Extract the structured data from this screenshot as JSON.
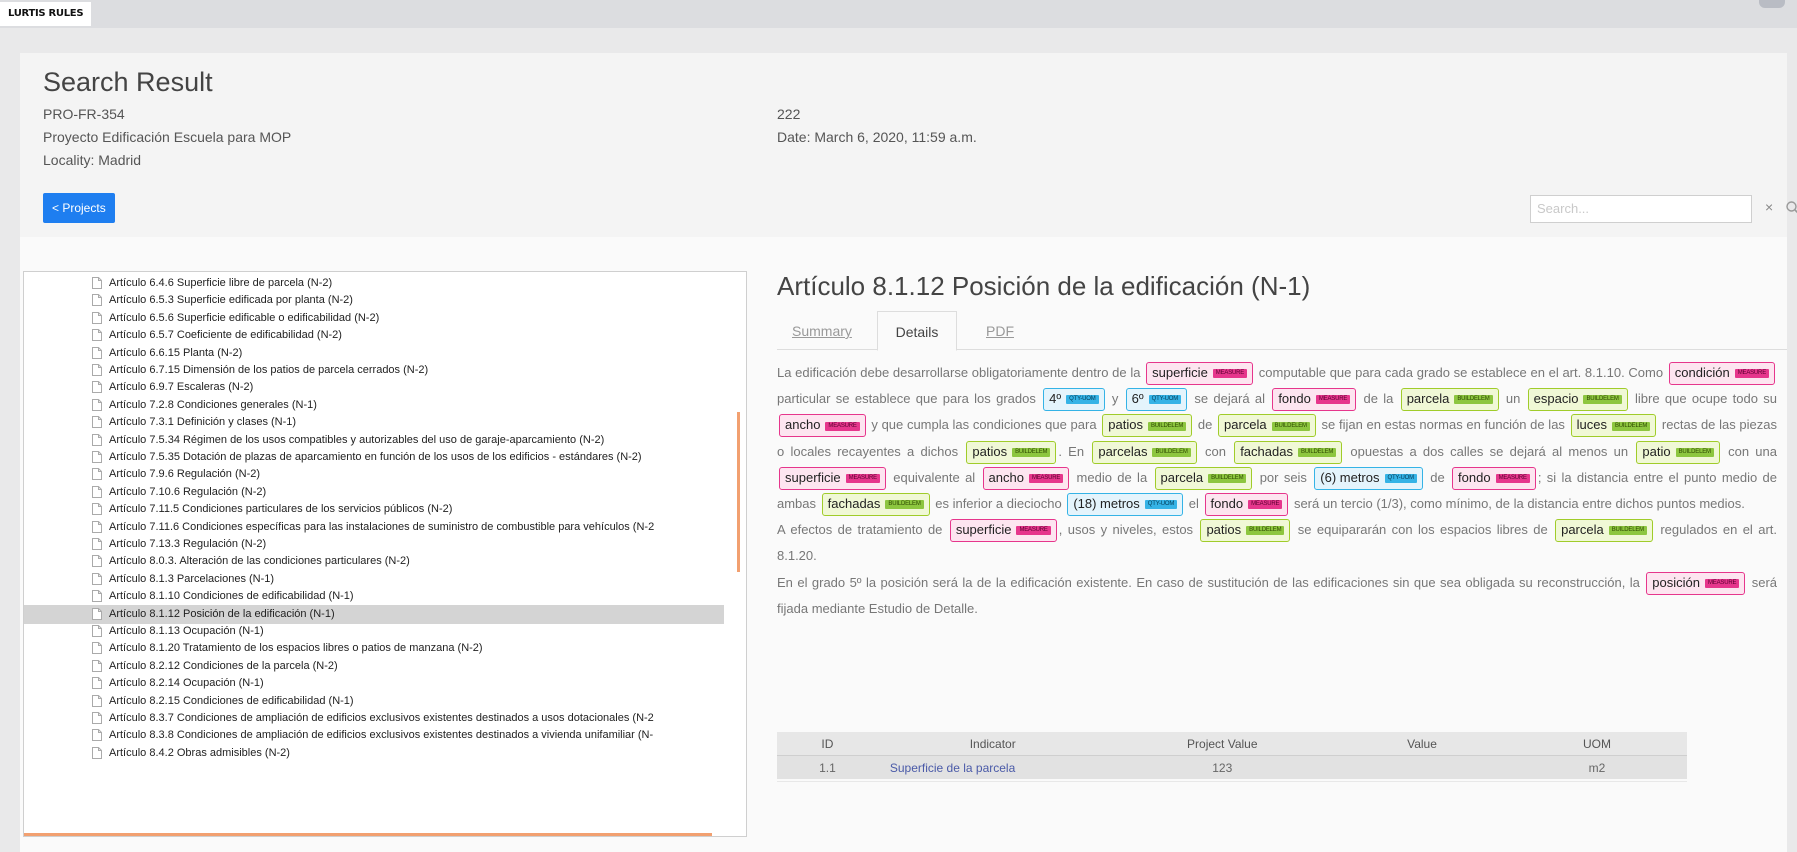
{
  "app": {
    "title": "LURTIS RULES"
  },
  "header": {
    "title": "Search Result",
    "project_code": "PRO-FR-354",
    "project_name": "Proyecto Edificación Escuela para MOP",
    "locality": "Locality: Madrid",
    "number": "222",
    "date": "Date: March 6, 2020, 11:59 a.m.",
    "back_button": "< Projects"
  },
  "search": {
    "placeholder": "Search...",
    "clear_symbol": "×",
    "icon": "search-icon"
  },
  "tree": {
    "items": [
      "Artículo 6.4.6 Superficie libre de parcela (N-2)",
      "Artículo 6.5.3 Superficie edificada por planta (N-2)",
      "Artículo 6.5.6 Superficie edificable o edificabilidad (N-2)",
      "Artículo 6.5.7 Coeficiente de edificabilidad (N-2)",
      "Artículo 6.6.15 Planta (N-2)",
      "Artículo 6.7.15 Dimensión de los patios de parcela cerrados (N-2)",
      "Artículo 6.9.7 Escaleras (N-2)",
      "Artículo 7.2.8 Condiciones generales (N-1)",
      "Artículo 7.3.1 Definición y clases (N-1)",
      "Artículo 7.5.34 Régimen de los usos compatibles y autorizables del uso de garaje-aparcamiento (N-2)",
      "Artículo 7.5.35 Dotación de plazas de aparcamiento en función de los usos de los edificios - estándares (N-2)",
      "Artículo 7.9.6 Regulación (N-2)",
      "Artículo 7.10.6 Regulación (N-2)",
      "Artículo 7.11.5 Condiciones particulares de los servicios públicos (N-2)",
      "Artículo 7.11.6 Condiciones específicas para las instalaciones de suministro de combustible para vehículos (N-2",
      "Artículo 7.13.3 Regulación (N-2)",
      "Artículo 8.0.3. Alteración de las condiciones particulares (N-2)",
      "Artículo 8.1.3 Parcelaciones (N-1)",
      "Artículo 8.1.10 Condiciones de edificabilidad (N-1)",
      "Artículo 8.1.12 Posición de la edificación (N-1)",
      "Artículo 8.1.13 Ocupación (N-1)",
      "Artículo 8.1.20 Tratamiento de los espacios libres o patios de manzana (N-2)",
      "Artículo 8.2.12 Condiciones de la parcela (N-2)",
      "Artículo 8.2.14 Ocupación (N-1)",
      "Artículo 8.2.15 Condiciones de edificabilidad (N-1)",
      "Artículo 8.3.7 Condiciones de ampliación de edificios exclusivos existentes destinados a usos dotacionales (N-2",
      "Artículo 8.3.8 Condiciones de ampliación de edificios exclusivos existentes destinados a vivienda unifamiliar (N-",
      "Artículo 8.4.2 Obras admisibles (N-2)"
    ],
    "selected_index": 19
  },
  "article": {
    "title": "Artículo 8.1.12 Posición de la edificación (N-1)",
    "tabs": [
      "Summary",
      "Details",
      "PDF"
    ],
    "active_tab": "Details",
    "tag_labels": {
      "measure": "MEASURE",
      "buildelem": "BUILDELEM",
      "qty": "QTY-UOM"
    },
    "paragraphs": [
      [
        {
          "t": "La edificación debe desarrollarse obligatoriamente dentro de la "
        },
        {
          "k": "superficie",
          "c": "measure"
        },
        {
          "t": " computable que para cada grado se establece en el art. 8.1.10. Como "
        },
        {
          "k": "condición",
          "c": "measure"
        },
        {
          "t": " particular se establece que para los grados "
        },
        {
          "k": "4º",
          "c": "qty"
        },
        {
          "t": " y "
        },
        {
          "k": "6º",
          "c": "qty"
        },
        {
          "t": " se dejará al "
        },
        {
          "k": "fondo",
          "c": "measure"
        },
        {
          "t": " de la "
        },
        {
          "k": "parcela",
          "c": "buildelem"
        },
        {
          "t": " un "
        },
        {
          "k": "espacio",
          "c": "buildelem"
        },
        {
          "t": " libre que ocupe todo su "
        },
        {
          "k": "ancho",
          "c": "measure"
        },
        {
          "t": " y que cumpla las condiciones que para "
        },
        {
          "k": "patios",
          "c": "buildelem"
        },
        {
          "t": " de "
        },
        {
          "k": "parcela",
          "c": "buildelem"
        },
        {
          "t": " se fijan en estas normas en función de las "
        },
        {
          "k": "luces",
          "c": "buildelem"
        },
        {
          "t": " rectas de las piezas o locales recayentes a dichos "
        },
        {
          "k": "patios",
          "c": "buildelem"
        },
        {
          "t": ". En "
        },
        {
          "k": "parcelas",
          "c": "buildelem"
        },
        {
          "t": " con "
        },
        {
          "k": "fachadas",
          "c": "buildelem"
        },
        {
          "t": " opuestas a dos calles se dejará al menos un "
        },
        {
          "k": "patio",
          "c": "buildelem"
        },
        {
          "t": " con una "
        },
        {
          "k": "superficie",
          "c": "measure"
        },
        {
          "t": " equivalente al "
        },
        {
          "k": "ancho",
          "c": "measure"
        },
        {
          "t": " medio de la "
        },
        {
          "k": "parcela",
          "c": "buildelem"
        },
        {
          "t": " por seis "
        },
        {
          "k": "(6) metros",
          "c": "qty"
        },
        {
          "t": " de "
        },
        {
          "k": "fondo",
          "c": "measure"
        },
        {
          "t": "; si la distancia entre el punto medio de ambas "
        },
        {
          "k": "fachadas",
          "c": "buildelem"
        },
        {
          "t": " es inferior a dieciocho "
        },
        {
          "k": "(18) metros",
          "c": "qty"
        },
        {
          "t": " el "
        },
        {
          "k": "fondo",
          "c": "measure"
        },
        {
          "t": " será un tercio (1/3), como mínimo, de la distancia entre dichos puntos medios."
        }
      ],
      [
        {
          "t": "A efectos de tratamiento de "
        },
        {
          "k": "superficie",
          "c": "measure"
        },
        {
          "t": ", usos y niveles, estos "
        },
        {
          "k": "patios",
          "c": "buildelem"
        },
        {
          "t": " se equipararán con los espacios libres de "
        },
        {
          "k": "parcela",
          "c": "buildelem"
        },
        {
          "t": " regulados en el art. 8.1.20."
        }
      ],
      [
        {
          "t": "En el grado 5º la posición será la de la edificación existente. En caso de sustitución de las edificaciones sin que sea obligada su reconstrucción, la "
        },
        {
          "k": "posición",
          "c": "measure"
        },
        {
          "t": " será fijada mediante Estudio de Detalle."
        }
      ]
    ]
  },
  "indicators": {
    "headers": [
      "ID",
      "Indicator",
      "Project Value",
      "Value",
      "UOM"
    ],
    "rows": [
      {
        "id": "1.1",
        "indicator": "Superficie de la parcela",
        "project_value": "123",
        "value": "",
        "uom": "m2"
      }
    ]
  },
  "colors": {
    "primary_button": "#1e7ef0",
    "measure_tag": "#e6368c",
    "buildelem_tag": "#8dc63f",
    "qty_tag": "#35b3e6",
    "scroll_accent": "#f2a070"
  }
}
